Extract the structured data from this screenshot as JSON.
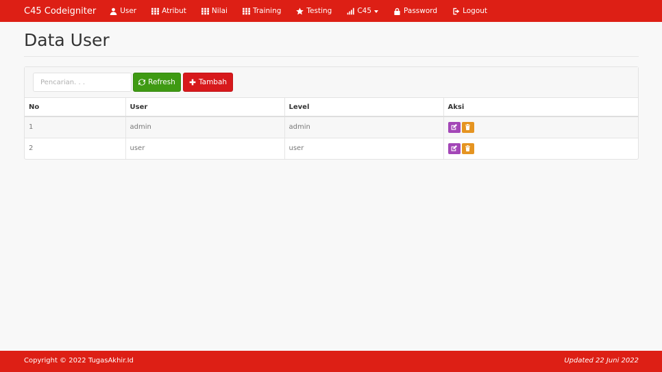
{
  "navbar": {
    "brand": "C45 Codeigniter",
    "items": [
      {
        "label": "User",
        "icon": "user-icon"
      },
      {
        "label": "Atribut",
        "icon": "grid-icon"
      },
      {
        "label": "Nilai",
        "icon": "grid-icon"
      },
      {
        "label": "Training",
        "icon": "grid-icon"
      },
      {
        "label": "Testing",
        "icon": "star-icon"
      },
      {
        "label": "C45",
        "icon": "signal-icon"
      },
      {
        "label": "Password",
        "icon": "lock-icon"
      },
      {
        "label": "Logout",
        "icon": "logout-icon"
      }
    ],
    "color": "#dd1f15"
  },
  "page": {
    "title": "Data User"
  },
  "toolbar": {
    "search_placeholder": "Pencarian. . .",
    "refresh_label": "Refresh",
    "add_label": "Tambah"
  },
  "table": {
    "headers": [
      "No",
      "User",
      "Level",
      "Aksi"
    ],
    "rows": [
      {
        "no": "1",
        "user": "admin",
        "level": "admin"
      },
      {
        "no": "2",
        "user": "user",
        "level": "user"
      }
    ]
  },
  "footer": {
    "copyright": "Copyright © 2022 TugasAkhir.Id",
    "updated": "Updated 22 Juni 2022"
  },
  "colors": {
    "primary": "#dd1f15",
    "success": "#3f9a13",
    "danger": "#d7191c",
    "edit": "#a347b7",
    "delete": "#e59421"
  }
}
